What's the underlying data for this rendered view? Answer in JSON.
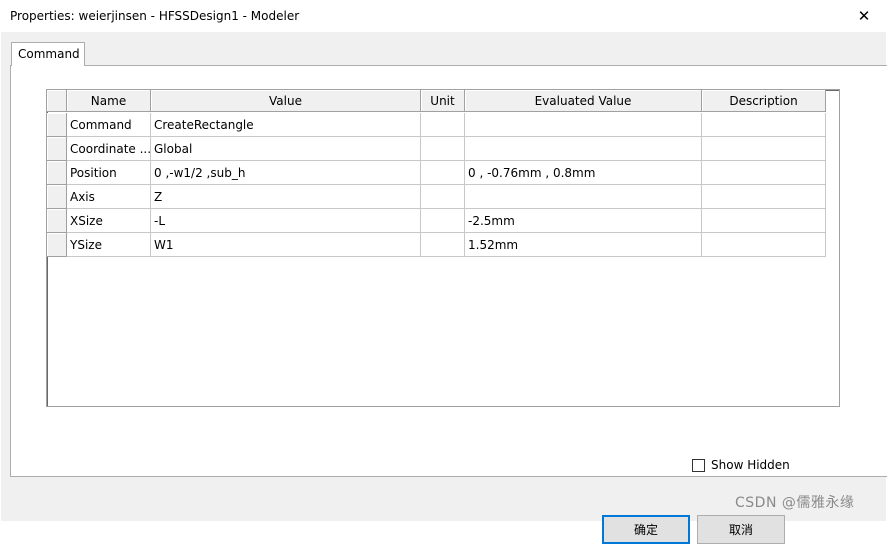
{
  "window": {
    "title": "Properties: weierjinsen - HFSSDesign1 - Modeler",
    "close_glyph": "✕"
  },
  "tabs": [
    {
      "label": "Command"
    }
  ],
  "grid": {
    "columns": [
      "Name",
      "Value",
      "Unit",
      "Evaluated Value",
      "Description"
    ],
    "rows": [
      {
        "name": "Command",
        "value": "CreateRectangle",
        "unit": "",
        "evaluated": "",
        "description": ""
      },
      {
        "name": "Coordinate ...",
        "value": "Global",
        "unit": "",
        "evaluated": "",
        "description": ""
      },
      {
        "name": "Position",
        "value": "0 ,-w1/2 ,sub_h",
        "unit": "",
        "evaluated": "0 , -0.76mm , 0.8mm",
        "description": ""
      },
      {
        "name": "Axis",
        "value": "Z",
        "unit": "",
        "evaluated": "",
        "description": ""
      },
      {
        "name": "XSize",
        "value": "-L",
        "unit": "",
        "evaluated": "-2.5mm",
        "description": ""
      },
      {
        "name": "YSize",
        "value": "W1",
        "unit": "",
        "evaluated": "1.52mm",
        "description": ""
      }
    ]
  },
  "show_hidden": {
    "label": "Show Hidden",
    "checked": false
  },
  "buttons": {
    "ok": "确定",
    "cancel": "取消"
  },
  "watermark": "CSDN @儒雅永缘"
}
